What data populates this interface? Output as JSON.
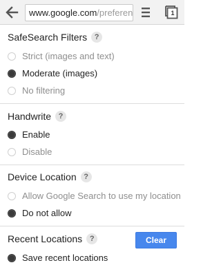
{
  "browser": {
    "url_host": "www.google.com",
    "url_path": "/preferences",
    "tab_count": "1"
  },
  "safesearch": {
    "title": "SafeSearch Filters",
    "help": "?",
    "options": [
      {
        "label": "Strict (images and text)",
        "checked": false
      },
      {
        "label": "Moderate (images)",
        "checked": true
      },
      {
        "label": "No filtering",
        "checked": false
      }
    ]
  },
  "handwrite": {
    "title": "Handwrite",
    "help": "?",
    "options": [
      {
        "label": "Enable",
        "checked": true
      },
      {
        "label": "Disable",
        "checked": false
      }
    ]
  },
  "location": {
    "title": "Device Location",
    "help": "?",
    "options": [
      {
        "label": "Allow Google Search to use my location",
        "checked": false
      },
      {
        "label": "Do not allow",
        "checked": true
      }
    ]
  },
  "recent": {
    "title": "Recent Locations",
    "help": "?",
    "clear_label": "Clear",
    "options": [
      {
        "label": "Save recent locations",
        "checked": true
      }
    ]
  }
}
